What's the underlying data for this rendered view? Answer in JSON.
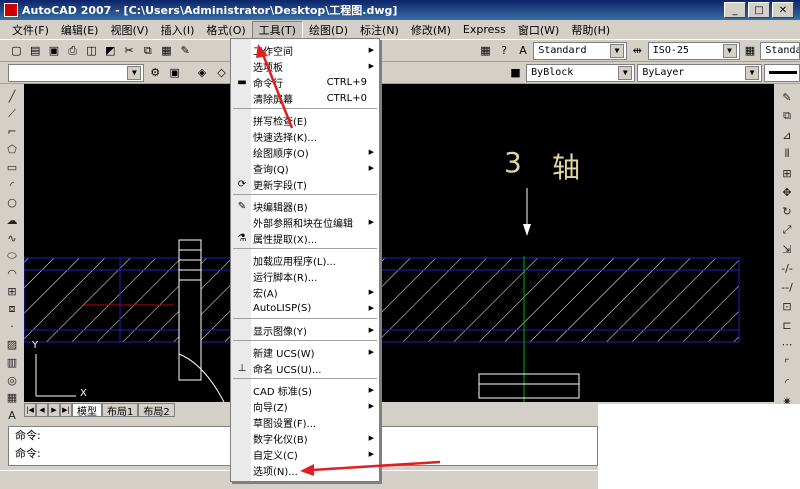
{
  "window": {
    "title": "AutoCAD 2007 - [C:\\Users\\Administrator\\Desktop\\工程图.dwg]",
    "buttons": [
      "_",
      "□",
      "✕"
    ]
  },
  "menubar": {
    "items": [
      {
        "label": "文件(F)"
      },
      {
        "label": "编辑(E)"
      },
      {
        "label": "视图(V)"
      },
      {
        "label": "插入(I)"
      },
      {
        "label": "格式(O)"
      },
      {
        "label": "工具(T)"
      },
      {
        "label": "绘图(D)"
      },
      {
        "label": "标注(N)"
      },
      {
        "label": "修改(M)"
      },
      {
        "label": "Express"
      },
      {
        "label": "窗口(W)"
      },
      {
        "label": "帮助(H)"
      }
    ],
    "active_index": 5
  },
  "toolbar1": {
    "text_style": "Standard",
    "dim_style": "ISO-25",
    "table_style": "Standard"
  },
  "toolbar2": {
    "layer": "",
    "color": "ByBlock",
    "linetype": "ByLayer"
  },
  "tools_menu": {
    "items": [
      {
        "label": "工作空间",
        "shortcut": "",
        "submenu": true,
        "icon": ""
      },
      {
        "label": "选项板",
        "shortcut": "",
        "submenu": true,
        "icon": ""
      },
      {
        "label": "命令行",
        "shortcut": "CTRL+9",
        "submenu": false,
        "icon": "command-line-icon"
      },
      {
        "label": "清除屏幕",
        "shortcut": "CTRL+0",
        "submenu": false,
        "icon": ""
      },
      {
        "label": "拼写检查(E)",
        "shortcut": "",
        "submenu": false,
        "icon": ""
      },
      {
        "label": "快速选择(K)...",
        "shortcut": "",
        "submenu": false,
        "icon": ""
      },
      {
        "label": "绘图顺序(O)",
        "shortcut": "",
        "submenu": true,
        "icon": ""
      },
      {
        "label": "查询(Q)",
        "shortcut": "",
        "submenu": true,
        "icon": ""
      },
      {
        "label": "更新字段(T)",
        "shortcut": "",
        "submenu": false,
        "icon": "update-field-icon"
      },
      {
        "label": "块编辑器(B)",
        "shortcut": "",
        "submenu": false,
        "icon": "block-editor-icon"
      },
      {
        "label": "外部参照和块在位编辑",
        "shortcut": "",
        "submenu": true,
        "icon": ""
      },
      {
        "label": "属性提取(X)...",
        "shortcut": "",
        "submenu": false,
        "icon": "attribute-extract-icon"
      },
      {
        "label": "加载应用程序(L)...",
        "shortcut": "",
        "submenu": false,
        "icon": ""
      },
      {
        "label": "运行脚本(R)...",
        "shortcut": "",
        "submenu": false,
        "icon": ""
      },
      {
        "label": "宏(A)",
        "shortcut": "",
        "submenu": true,
        "icon": ""
      },
      {
        "label": "AutoLISP(S)",
        "shortcut": "",
        "submenu": true,
        "icon": ""
      },
      {
        "label": "显示图像(Y)",
        "shortcut": "",
        "submenu": true,
        "icon": ""
      },
      {
        "label": "新建 UCS(W)",
        "shortcut": "",
        "submenu": true,
        "icon": ""
      },
      {
        "label": "命名 UCS(U)...",
        "shortcut": "",
        "submenu": false,
        "icon": "named-ucs-icon"
      },
      {
        "label": "CAD 标准(S)",
        "shortcut": "",
        "submenu": true,
        "icon": ""
      },
      {
        "label": "向导(Z)",
        "shortcut": "",
        "submenu": true,
        "icon": ""
      },
      {
        "label": "草图设置(F)...",
        "shortcut": "",
        "submenu": false,
        "icon": ""
      },
      {
        "label": "数字化仪(B)",
        "shortcut": "",
        "submenu": true,
        "icon": ""
      },
      {
        "label": "自定义(C)",
        "shortcut": "",
        "submenu": true,
        "icon": ""
      },
      {
        "label": "选项(N)...",
        "shortcut": "",
        "submenu": false,
        "icon": ""
      }
    ]
  },
  "drawing": {
    "annotation_number": "3",
    "annotation_text": "轴",
    "ucs_x": "X",
    "ucs_y": "Y"
  },
  "layout_tabs": [
    "模型",
    "布局1",
    "布局2"
  ],
  "command_lines": [
    "命令:",
    "命令:"
  ],
  "colors": {
    "canvas": "#000000",
    "hatch": "#ffffff",
    "outline": "#2020c0",
    "centerline": "#00b000",
    "arrow_annotation": "#e02020",
    "menu_highlight_bar": "#0a246a"
  }
}
